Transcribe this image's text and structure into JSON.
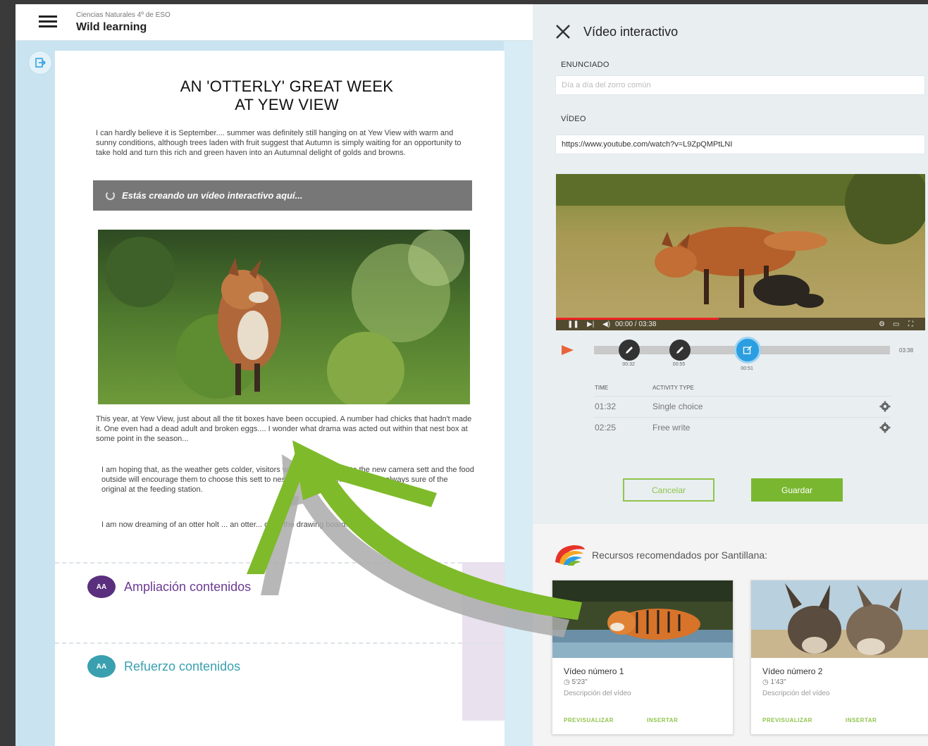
{
  "app": {
    "course": "Ciencias Naturales 4º de ESO",
    "title": "Wild learning"
  },
  "article": {
    "headline_line1": "AN 'OTTERLY' GREAT WEEK",
    "headline_line2": "AT YEW VIEW",
    "paragraph1": "I can hardly believe it is September.... summer was definitely still hanging on at Yew View with warm and sunny conditions, although trees laden with fruit suggest that Autumn is simply waiting for an opportunity to take hold and turn this rich and green haven into an Autumnal delight of golds and browns.",
    "banner": "Estás creando un vídeo interactivo aquí...",
    "paragraph2": "This year, at Yew View, just about all the tit boxes have been occupied. A number had chicks that hadn't made it. One even had a dead adult and broken eggs.... I wonder what drama was acted out within that nest box at some point in the season...",
    "paragraph3": "I am hoping that, as the weather gets colder, visitors will further investigate the new camera sett and the food outside will encourage them to choose this sett to nest in. In the meantime, we are always sure of the original at the feeding station.",
    "paragraph4": "I am now dreaming of an otter holt ... an otter... off to the drawing board!!!!"
  },
  "sections": [
    {
      "label": "Ampliación contenidos",
      "badge": "AA"
    },
    {
      "label": "Refuerzo contenidos",
      "badge": "AA"
    }
  ],
  "panel": {
    "title": "Vídeo interactivo",
    "enunciado_label": "ENUNCIADO",
    "enunciado_placeholder": "Día a día del zorro común",
    "video_label": "VÍDEO",
    "video_url": "https://www.youtube.com/watch?v=L9ZpQMPtLNI",
    "player_time": "00:00 / 03:38",
    "timeline": {
      "markers": [
        {
          "time": "00:32",
          "position": 0.12
        },
        {
          "time": "00:55",
          "position": 0.29
        },
        {
          "time": "00:51",
          "position": 0.52,
          "active": true
        }
      ],
      "end_time": "03:38"
    },
    "table": {
      "headers": [
        "TIME",
        "ACTIVITY TYPE"
      ],
      "rows": [
        {
          "time": "01:32",
          "type": "Single choice"
        },
        {
          "time": "02:25",
          "type": "Free write"
        }
      ]
    },
    "cancel_label": "Cancelar",
    "save_label": "Guardar",
    "recommend_title": "Recursos recomendados por Santillana:",
    "cards": [
      {
        "title": "Vídeo número 1",
        "duration": "5'23\"",
        "desc": "Descripción del vídeo",
        "preview": "PREVISUALIZAR",
        "insert": "INSERTAR"
      },
      {
        "title": "Vídeo número 2",
        "duration": "1'43\"",
        "desc": "Descripción del vídeo",
        "preview": "PREVISUALIZAR",
        "insert": "INSERTAR"
      }
    ]
  },
  "colors": {
    "accent_green": "#7ab730",
    "ampliacion_purple": "#5a2f7d",
    "refuerzo_teal": "#3aa0b0",
    "marker_active": "#2a9ee0",
    "banner_gray": "#777777"
  }
}
